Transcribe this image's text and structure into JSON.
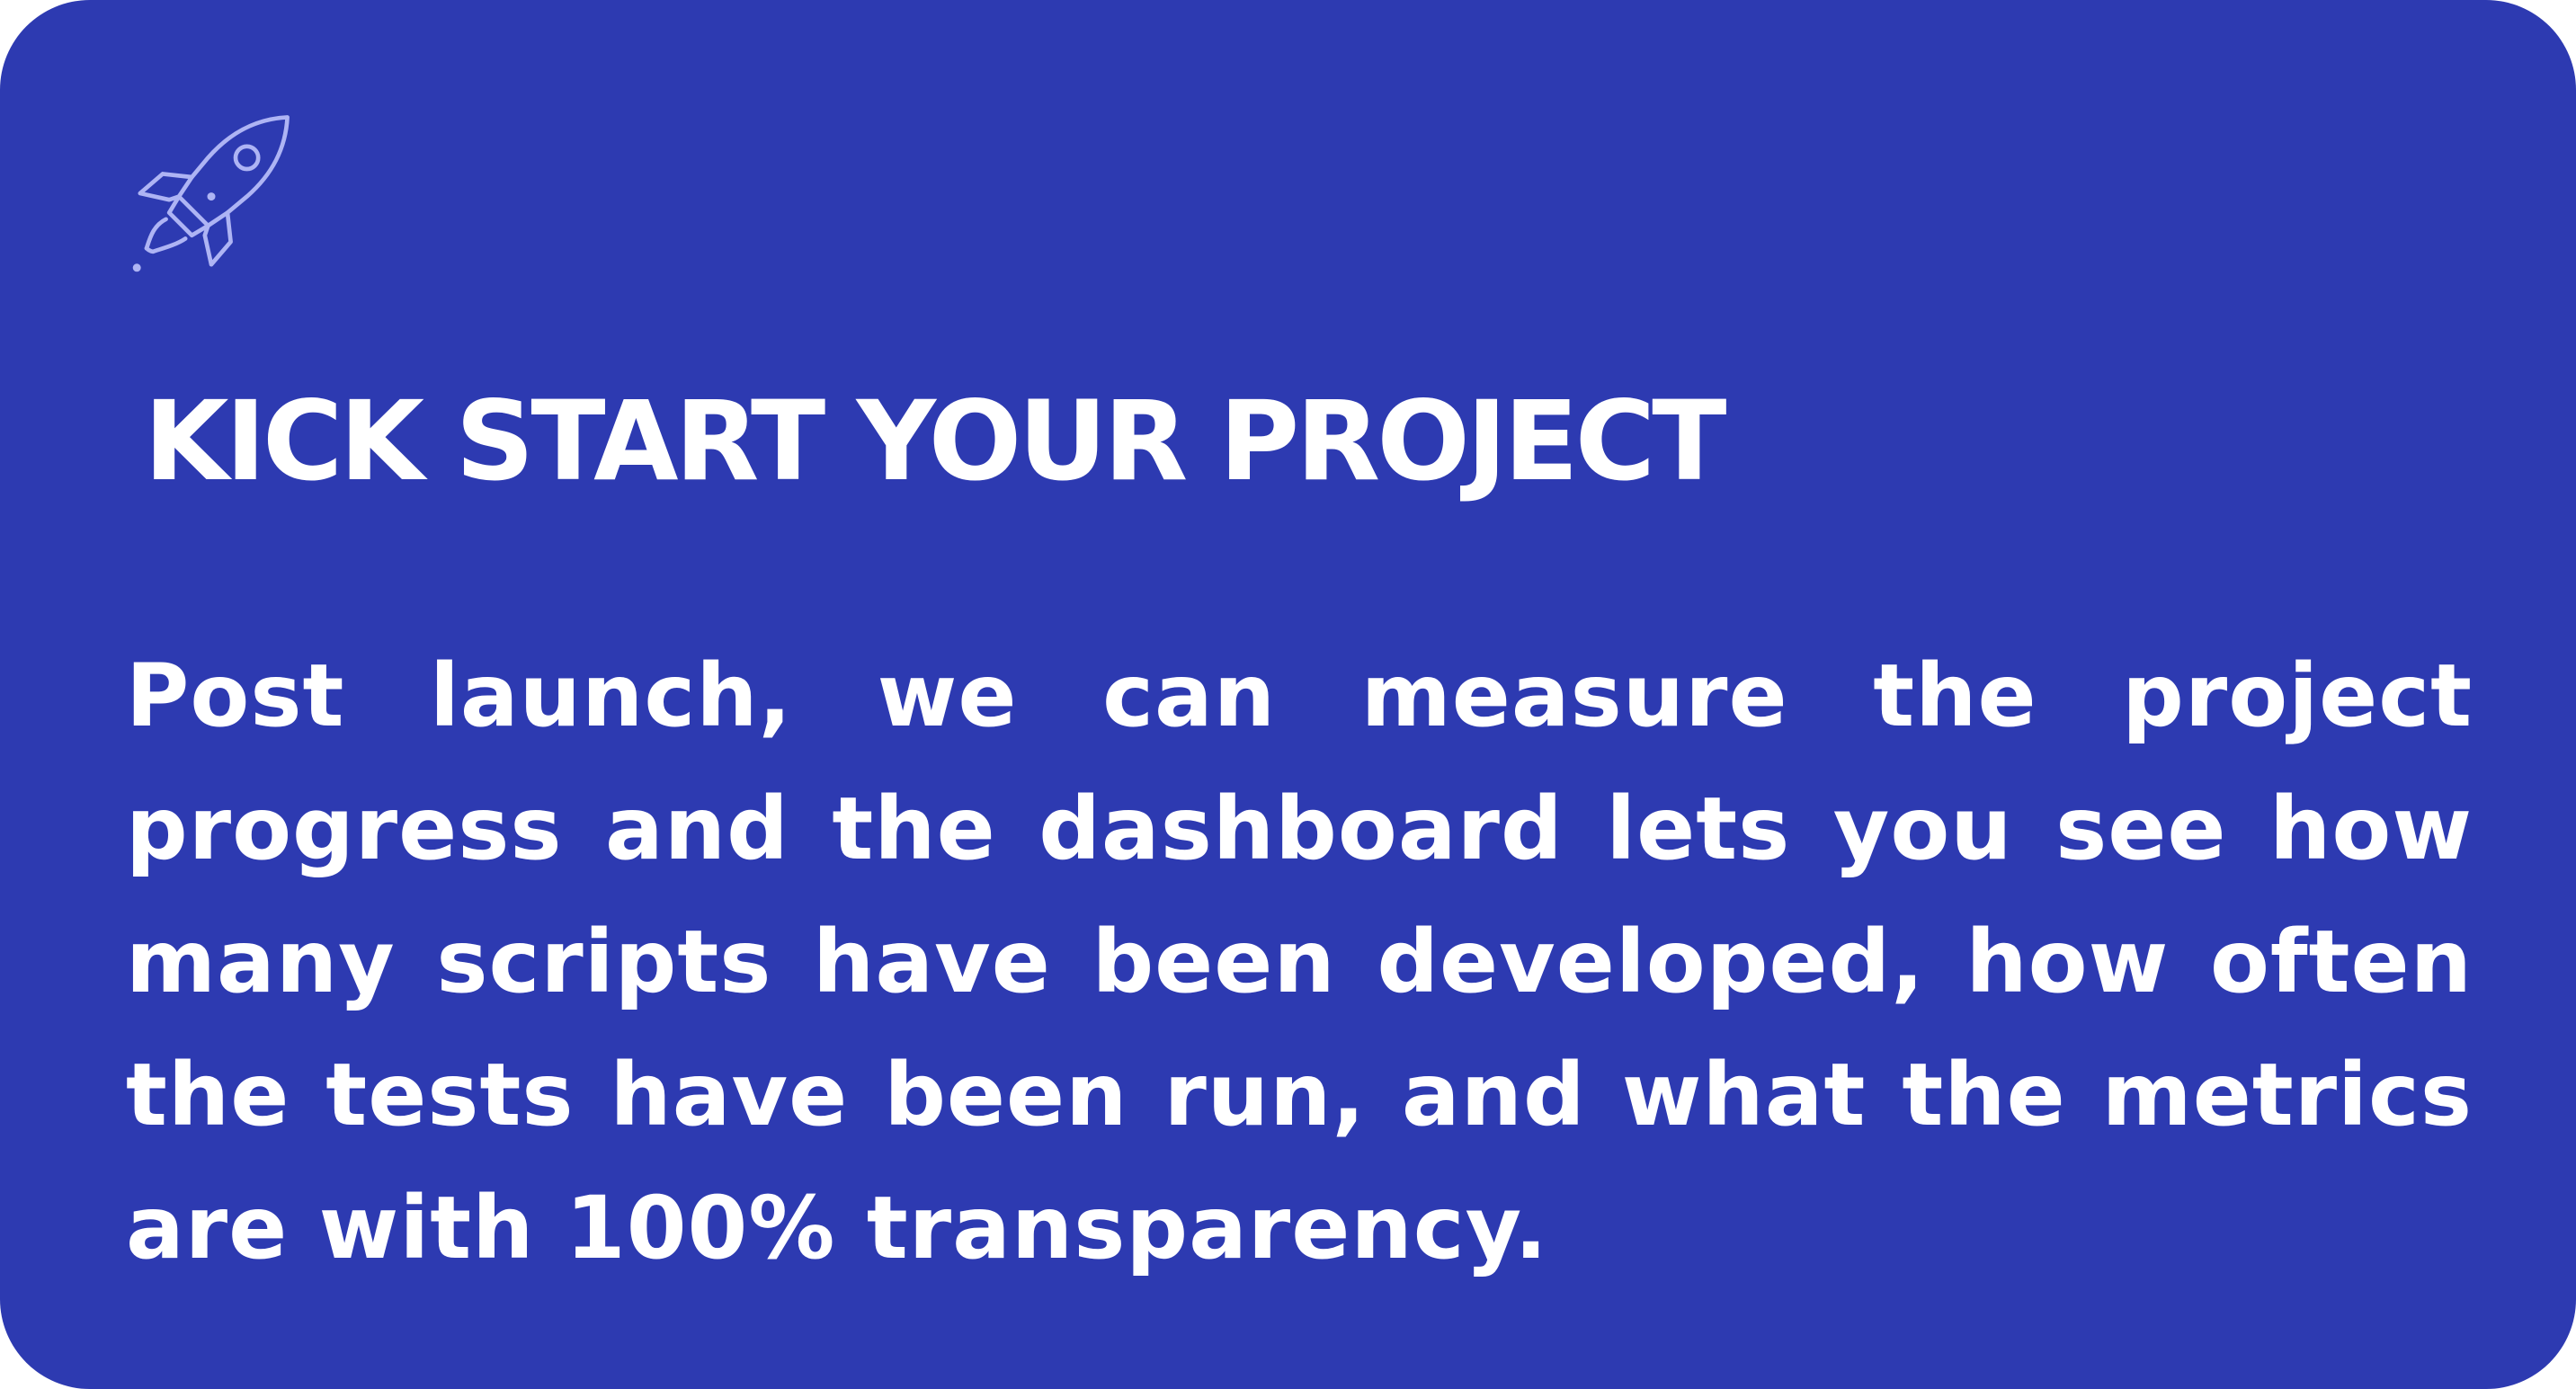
{
  "card": {
    "background_color": "#2d3ab1",
    "icon": "rocket-icon",
    "icon_color": "#aeb4f4",
    "title": "KICK START YOUR PROJECT",
    "body": "Post launch, we can measure the project progress and the dashboard lets you see how many scripts have been developed, how often the tests have been run, and what the metrics are with 100% transparency."
  }
}
